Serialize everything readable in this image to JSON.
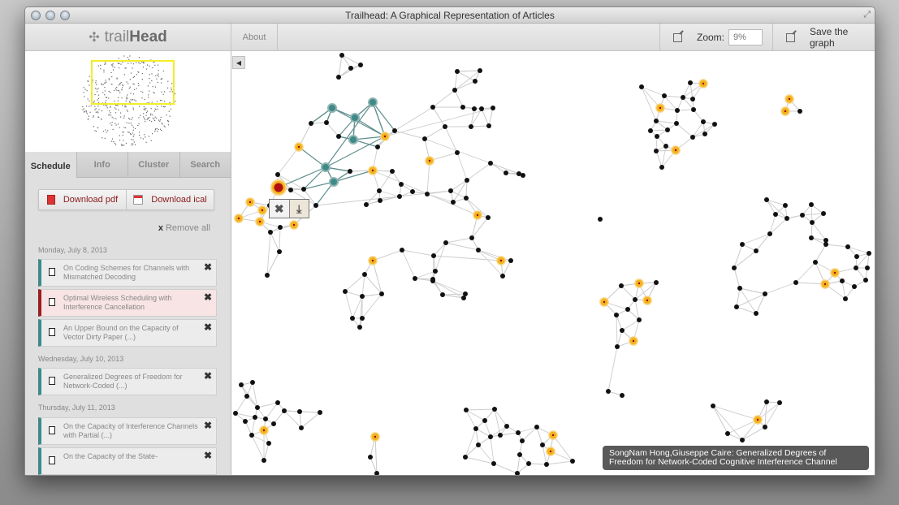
{
  "window": {
    "title": "Trailhead: A Graphical Representation of Articles"
  },
  "toolbar": {
    "logo_light": "trail",
    "logo_bold": "Head",
    "about_label": "About",
    "zoom_label": "Zoom:",
    "zoom_placeholder": "9%",
    "save_label": "Save the graph"
  },
  "sidebar": {
    "tabs": [
      {
        "label": "Schedule",
        "active": true
      },
      {
        "label": "Info",
        "active": false
      },
      {
        "label": "Cluster",
        "active": false
      },
      {
        "label": "Search",
        "active": false
      }
    ],
    "download_pdf": "Download pdf",
    "download_ical": "Download ical",
    "remove_all": "Remove all",
    "days": [
      {
        "date": "Monday, July 8, 2013",
        "papers": [
          {
            "title": "On Coding Schemes for Channels with Mismatched Decoding",
            "highlighted": false
          },
          {
            "title": "Optimal Wireless Scheduling with Interference Cancellation",
            "highlighted": true
          },
          {
            "title": "An Upper Bound on the Capacity of Vector Dirty Paper (...)",
            "highlighted": false
          }
        ]
      },
      {
        "date": "Wednesday, July 10, 2013",
        "papers": [
          {
            "title": "Generalized Degrees of Freedom for Network-Coded (...)",
            "highlighted": false
          }
        ]
      },
      {
        "date": "Thursday, July 11, 2013",
        "papers": [
          {
            "title": "On the Capacity of Interference Channels with Partial (...)",
            "highlighted": false
          },
          {
            "title": "On the Capacity of the State-",
            "highlighted": false
          }
        ]
      }
    ]
  },
  "graph": {
    "tooltip": "SongNam Hong,Giuseppe Caire: Generalized Degrees of Freedom for Network-Coded Cognitive Interference Channel",
    "colors": {
      "node": "#111111",
      "highlight": "#f5b21c",
      "cluster": "#3f8a88",
      "selected": "#b01010",
      "edge": "#cccccc"
    }
  }
}
